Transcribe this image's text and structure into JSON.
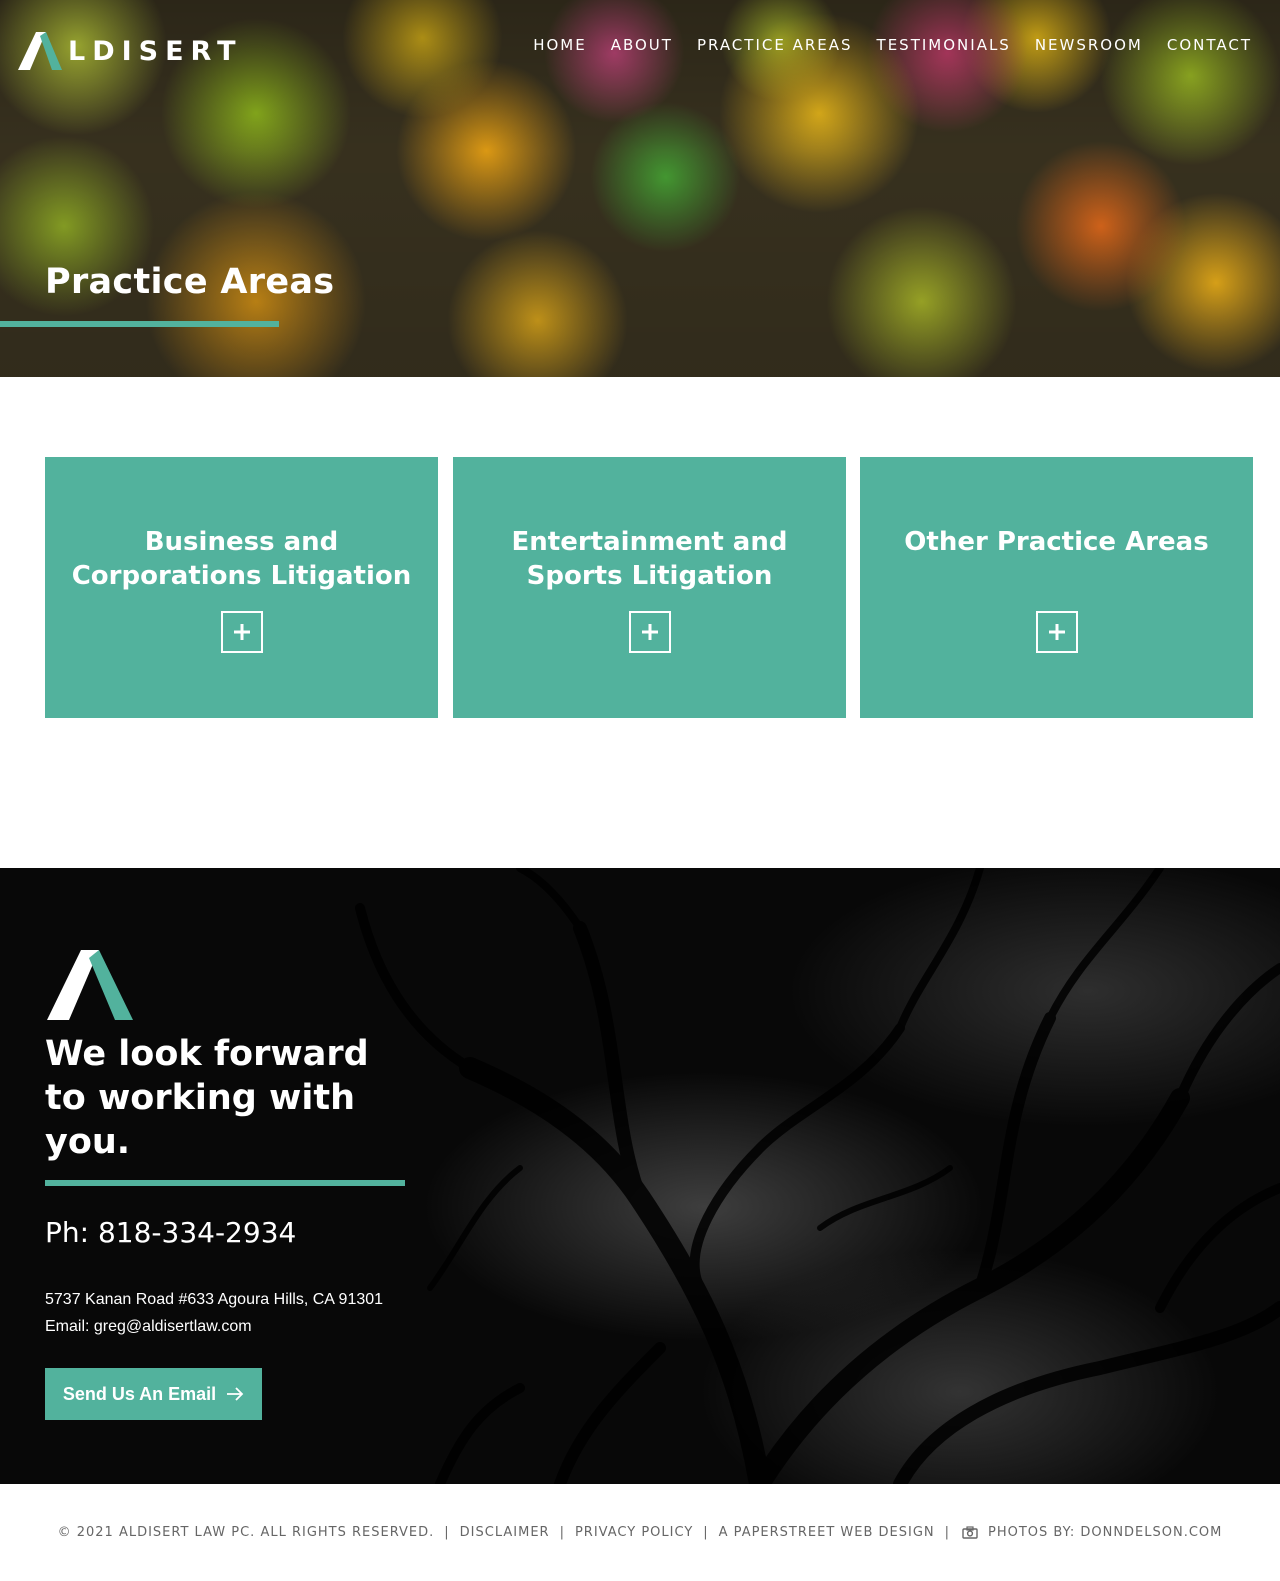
{
  "brand": {
    "logo_text": "LDISERT",
    "accent_color": "#52b29d"
  },
  "nav": {
    "items": [
      {
        "label": "HOME"
      },
      {
        "label": "ABOUT"
      },
      {
        "label": "PRACTICE AREAS"
      },
      {
        "label": "TESTIMONIALS"
      },
      {
        "label": "NEWSROOM"
      },
      {
        "label": "CONTACT"
      }
    ]
  },
  "hero": {
    "title": "Practice Areas"
  },
  "cards": [
    {
      "title": "Business and Corporations Litigation",
      "icon": "plus-icon"
    },
    {
      "title": "Entertainment and Sports Litigation",
      "icon": "plus-icon"
    },
    {
      "title": "Other Practice Areas",
      "icon": "plus-icon"
    }
  ],
  "cta": {
    "heading_line1": "We look forward",
    "heading_line2": "to working with you.",
    "phone": "Ph: 818-334-2934",
    "address": "5737 Kanan Road #633 Agoura Hills, CA 91301",
    "email": "Email: greg@aldisertlaw.com",
    "button_label": "Send Us An Email",
    "button_icon": "arrow-right-icon"
  },
  "footer": {
    "copyright": "© 2021 ALDISERT LAW PC. ALL RIGHTS RESERVED.",
    "disclaimer": "DISCLAIMER",
    "privacy": "PRIVACY POLICY",
    "design": "A PAPERSTREET WEB DESIGN",
    "photos": "PHOTOS BY: DONNDELSON.COM",
    "separator": "|"
  }
}
